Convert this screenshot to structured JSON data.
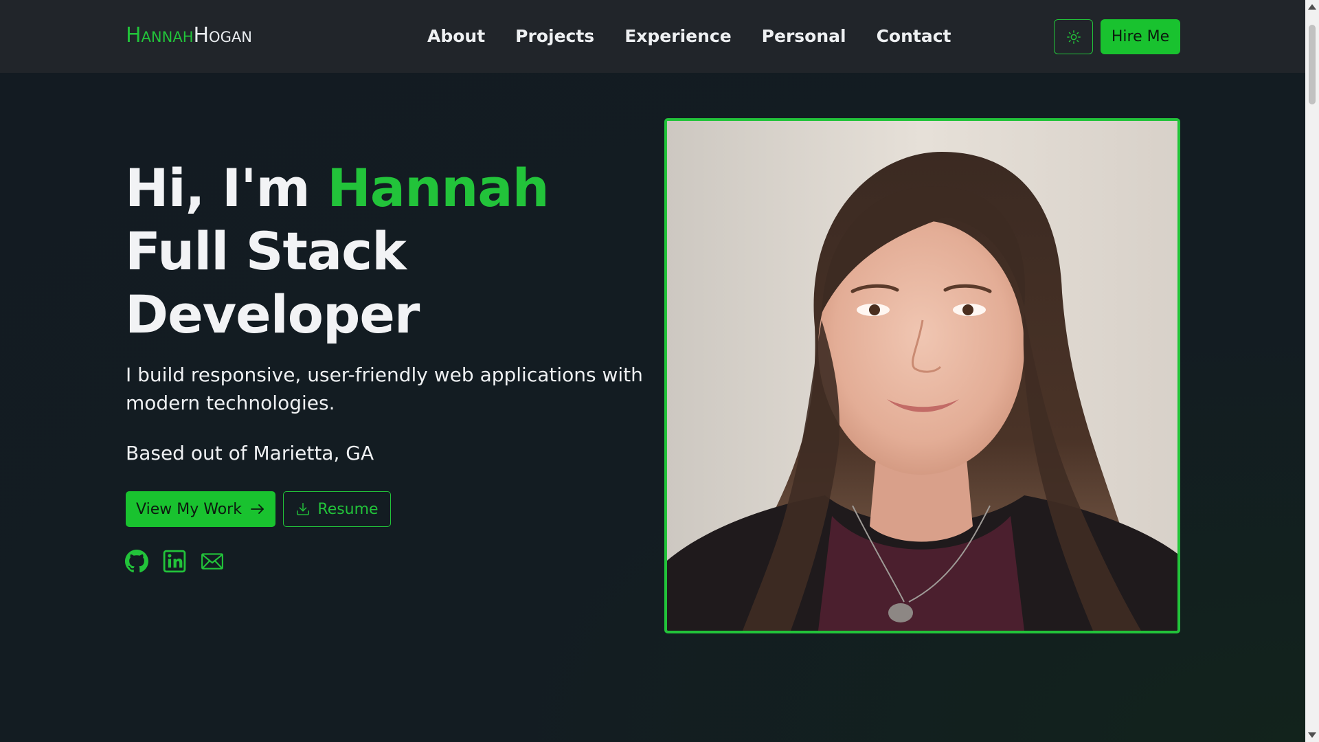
{
  "colors": {
    "accent": "#22c33a",
    "button_fill": "#19c22f",
    "navbar_bg": "#21252a",
    "page_bg": "#131c22",
    "text": "#f2f3f5"
  },
  "logo": {
    "first": "Hannah",
    "last": "Hogan"
  },
  "nav": {
    "links": [
      {
        "label": "About"
      },
      {
        "label": "Projects"
      },
      {
        "label": "Experience"
      },
      {
        "label": "Personal"
      },
      {
        "label": "Contact"
      }
    ],
    "theme_toggle_icon": "sun-icon",
    "hire_label": "Hire Me"
  },
  "hero": {
    "greeting_prefix": "Hi, I'm",
    "name": "Hannah",
    "role_line1": "Full Stack",
    "role_line2": "Developer",
    "tagline": "I build responsive, user-friendly web applications with modern technologies.",
    "location": "Based out of Marietta, GA",
    "primary_button": {
      "label": "View My Work",
      "icon": "arrow-right-icon"
    },
    "secondary_button": {
      "label": "Resume",
      "icon": "download-icon"
    },
    "socials": [
      {
        "icon": "github-icon"
      },
      {
        "icon": "linkedin-icon"
      },
      {
        "icon": "mail-icon"
      }
    ]
  },
  "portrait": {
    "icon": "portrait-photo"
  }
}
